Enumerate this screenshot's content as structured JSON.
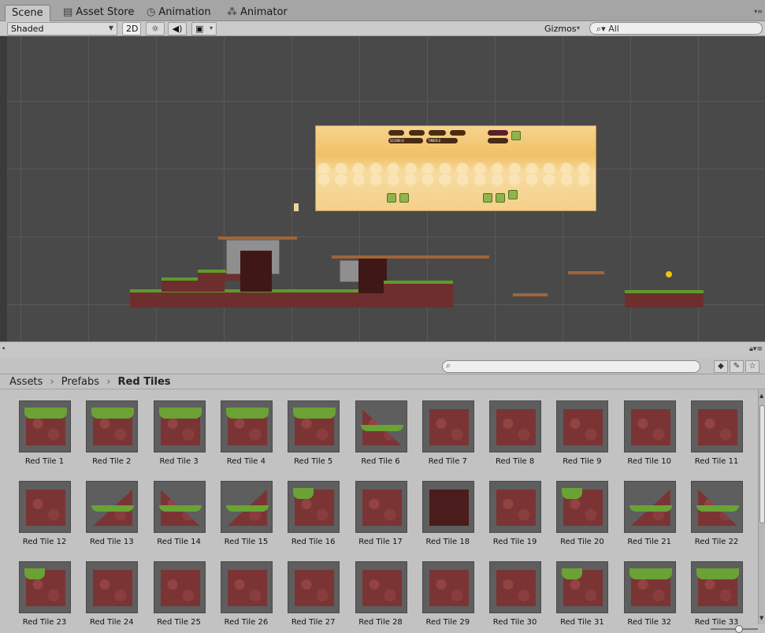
{
  "tabs": [
    {
      "label": "Scene",
      "icon": "none"
    },
    {
      "label": "Asset Store",
      "icon": "store-icon"
    },
    {
      "label": "Animation",
      "icon": "clock-icon"
    },
    {
      "label": "Animator",
      "icon": "animator-icon"
    }
  ],
  "scene_toolbar": {
    "shading_mode": "Shaded",
    "mode_2d": "2D",
    "gizmos_label": "Gizmos",
    "search_value": "All"
  },
  "level_hud": {
    "score_label": "SCORE:0",
    "timer_label": "TIMER:0"
  },
  "breadcrumb": {
    "root": "Assets",
    "folder": "Prefabs",
    "current": "Red Tiles"
  },
  "assets": [
    {
      "label": "Red Tile 1",
      "variant": "grass-top"
    },
    {
      "label": "Red Tile 2",
      "variant": "grass-top"
    },
    {
      "label": "Red Tile 3",
      "variant": "grass-top"
    },
    {
      "label": "Red Tile 4",
      "variant": "grass-top"
    },
    {
      "label": "Red Tile 5",
      "variant": "grass-top"
    },
    {
      "label": "Red Tile 6",
      "variant": "slope"
    },
    {
      "label": "Red Tile 7",
      "variant": "brick"
    },
    {
      "label": "Red Tile 8",
      "variant": "brick"
    },
    {
      "label": "Red Tile 9",
      "variant": "brick"
    },
    {
      "label": "Red Tile 10",
      "variant": "brick"
    },
    {
      "label": "Red Tile 11",
      "variant": "brick"
    },
    {
      "label": "Red Tile 12",
      "variant": "brick"
    },
    {
      "label": "Red Tile 13",
      "variant": "slope"
    },
    {
      "label": "Red Tile 14",
      "variant": "slope"
    },
    {
      "label": "Red Tile 15",
      "variant": "slope"
    },
    {
      "label": "Red Tile 16",
      "variant": "grass-corner"
    },
    {
      "label": "Red Tile 17",
      "variant": "brick"
    },
    {
      "label": "Red Tile 18",
      "variant": "dark"
    },
    {
      "label": "Red Tile 19",
      "variant": "brick"
    },
    {
      "label": "Red Tile 20",
      "variant": "grass-corner"
    },
    {
      "label": "Red Tile 21",
      "variant": "slope"
    },
    {
      "label": "Red Tile 22",
      "variant": "slope"
    },
    {
      "label": "Red Tile 23",
      "variant": "grass-corner"
    },
    {
      "label": "Red Tile 24",
      "variant": "brick"
    },
    {
      "label": "Red Tile 25",
      "variant": "brick"
    },
    {
      "label": "Red Tile 26",
      "variant": "brick"
    },
    {
      "label": "Red Tile 27",
      "variant": "brick"
    },
    {
      "label": "Red Tile 28",
      "variant": "brick"
    },
    {
      "label": "Red Tile 29",
      "variant": "brick"
    },
    {
      "label": "Red Tile 30",
      "variant": "brick"
    },
    {
      "label": "Red Tile 31",
      "variant": "grass-corner"
    },
    {
      "label": "Red Tile 32",
      "variant": "grass-top"
    },
    {
      "label": "Red Tile 33",
      "variant": "grass-top"
    }
  ],
  "colors": {
    "viewport_bg": "#494949",
    "panel_bg": "#c2c2c2",
    "tile_red": "#7a3434",
    "grass": "#6aa236",
    "sky": "#f0c067"
  }
}
